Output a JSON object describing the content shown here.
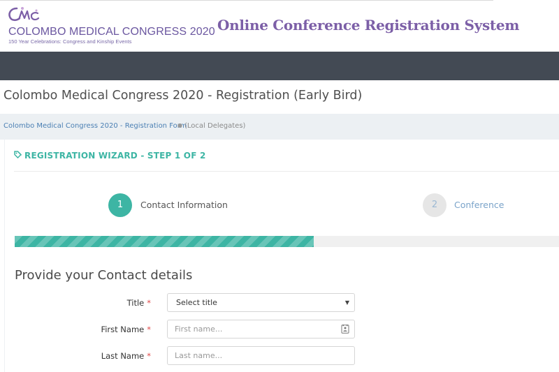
{
  "header": {
    "logo_title": "COLOMBO MEDICAL CONGRESS 2020",
    "logo_subtitle": "150 Year Celebrations: Congress and Kinship Events",
    "system_title": "Online Conference Registration System"
  },
  "page": {
    "title": "Colombo Medical Congress 2020 - Registration (Early Bird)"
  },
  "breadcrumb": {
    "link": "Colombo Medical Congress 2020 - Registration Form",
    "separator": "●",
    "current": "(Local Delegates)"
  },
  "wizard": {
    "header": "REGISTRATION WIZARD - STEP 1 OF 2",
    "steps": [
      {
        "number": "1",
        "label": "Contact Information",
        "active": true
      },
      {
        "number": "2",
        "label": "Conference",
        "active": false
      }
    ],
    "progress_fraction": 0.55
  },
  "form": {
    "section_title": "Provide your Contact details",
    "required_marker": "*",
    "title_label": "Title",
    "title_selected": "Select title",
    "first_name_label": "First Name",
    "first_name_placeholder": "First name...",
    "last_name_label": "Last Name",
    "last_name_placeholder": "Last name..."
  },
  "colors": {
    "accent": "#3db5a4",
    "brand_purple": "#7c5fa7",
    "navbar": "#434a54",
    "link": "#4a7fb3",
    "required": "#e04b4b"
  },
  "icons": {
    "wizard_header_icon": "tag-icon",
    "step_inactive_label_color": "#7aa3c9",
    "select_caret": "caret-down-icon",
    "first_name_icon": "contact-card-icon"
  }
}
